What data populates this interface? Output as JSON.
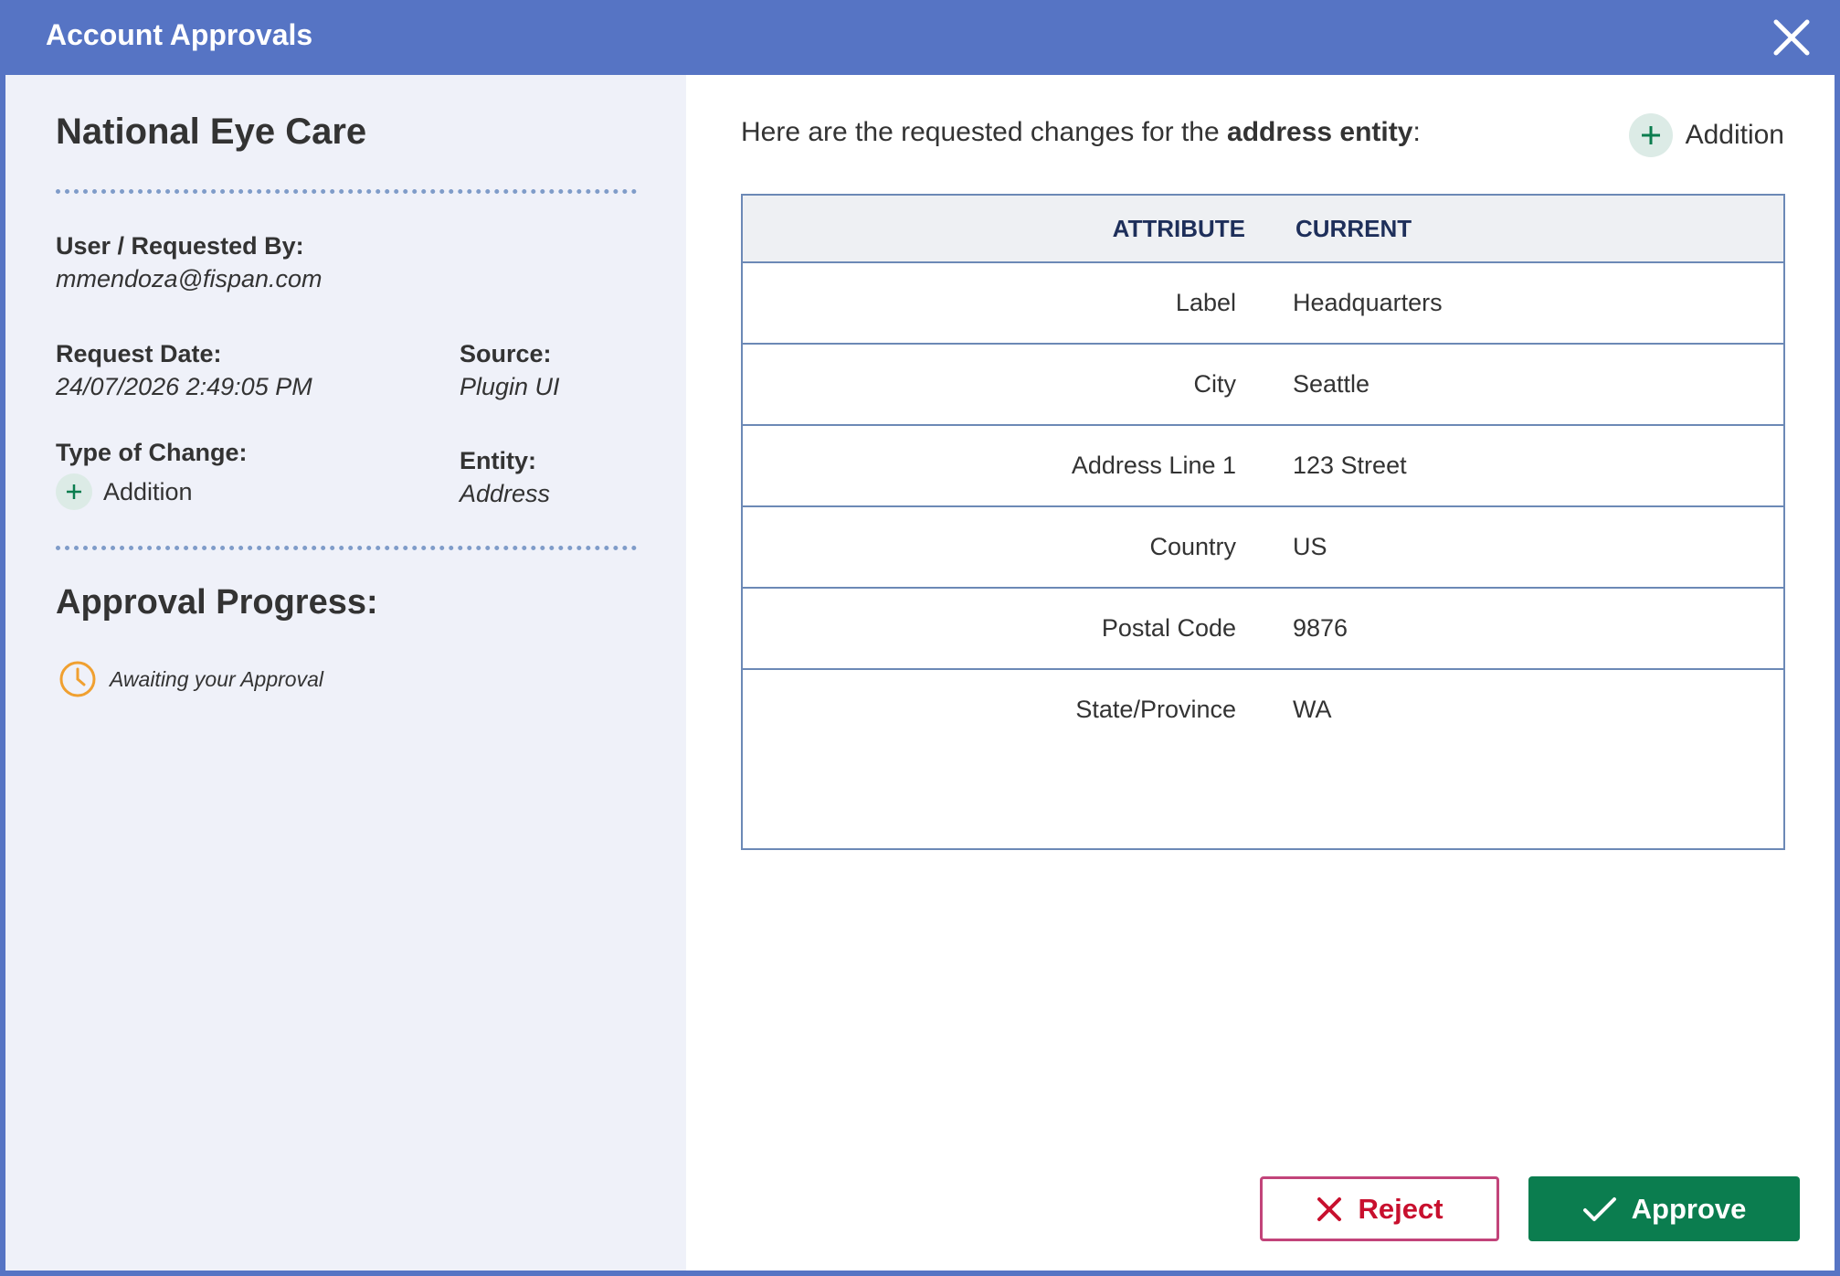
{
  "window": {
    "title": "Account Approvals"
  },
  "left": {
    "account_name": "National Eye Care",
    "requested_by_label": "User / Requested By:",
    "requested_by_value": "mmendoza@fispan.com",
    "request_date_label": "Request Date:",
    "request_date_value": "24/07/2026 2:49:05 PM",
    "source_label": "Source:",
    "source_value": "Plugin UI",
    "type_label": "Type of Change:",
    "type_value": "Addition",
    "entity_label": "Entity:",
    "entity_value": "Address",
    "progress_title": "Approval Progress:",
    "progress_status": "Awaiting your Approval"
  },
  "right": {
    "intro_prefix": "Here are the requested changes for the ",
    "intro_bold": "address entity",
    "intro_suffix": ":",
    "legend_label": "Addition",
    "table": {
      "headers": [
        "ATTRIBUTE",
        "CURRENT"
      ],
      "rows": [
        {
          "attribute": "Label",
          "current": "Headquarters"
        },
        {
          "attribute": "City",
          "current": "Seattle"
        },
        {
          "attribute": "Address Line 1",
          "current": "123 Street"
        },
        {
          "attribute": "Country",
          "current": "US"
        },
        {
          "attribute": "Postal Code",
          "current": "9876"
        },
        {
          "attribute": "State/Province",
          "current": "WA"
        }
      ]
    },
    "reject_label": "Reject",
    "approve_label": "Approve"
  },
  "colors": {
    "header": "#5674c4",
    "left_panel": "#eff1f9",
    "addition_green": "#0b7d4f",
    "reject_red": "#c8102e",
    "pending_orange": "#f0a030"
  },
  "icons": [
    "close-icon",
    "plus-icon",
    "clock-icon",
    "x-icon",
    "check-icon"
  ]
}
